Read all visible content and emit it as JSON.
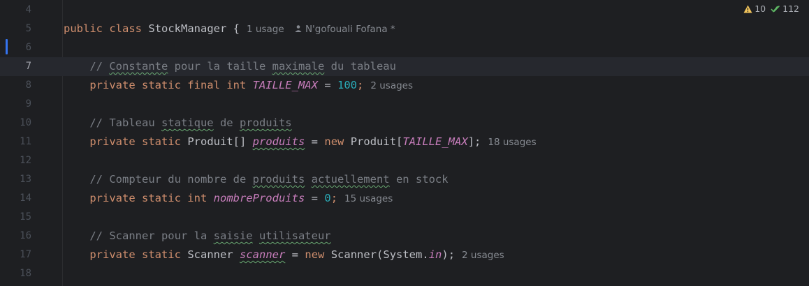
{
  "editor": {
    "current_line": 7,
    "inspection": {
      "warning_count": "10",
      "ok_count": "112"
    },
    "lines": [
      {
        "number": "4"
      },
      {
        "number": "5",
        "text": [
          "public",
          "class",
          "StockManager {"
        ],
        "hint": "1 usage",
        "author": "N'gofouali Fofana *"
      },
      {
        "number": "6"
      },
      {
        "number": "7",
        "comment": [
          "// ",
          "Constante",
          " pour la taille ",
          "maximale",
          " du tableau"
        ]
      },
      {
        "number": "8",
        "text": [
          "private static final int",
          "TAILLE_MAX",
          "=",
          "100",
          ";"
        ],
        "hint": "2 usages"
      },
      {
        "number": "9"
      },
      {
        "number": "10",
        "comment": [
          "// Tableau ",
          "statique",
          " de ",
          "produits"
        ]
      },
      {
        "number": "11",
        "text": [
          "private static",
          "Produit[]",
          "produits",
          "=",
          "new",
          "Produit[",
          "TAILLE_MAX",
          "];"
        ],
        "hint": "18 usages"
      },
      {
        "number": "12"
      },
      {
        "number": "13",
        "comment": [
          "// Compteur du nombre de ",
          "produits",
          " ",
          "actuellement",
          " en stock"
        ]
      },
      {
        "number": "14",
        "text": [
          "private static int",
          "nombreProduits",
          "=",
          "0",
          ";"
        ],
        "hint": "15 usages"
      },
      {
        "number": "15"
      },
      {
        "number": "16",
        "comment": [
          "// Scanner pour la ",
          "saisie",
          " ",
          "utilisateur"
        ]
      },
      {
        "number": "17",
        "text": [
          "private static",
          "Scanner",
          "scanner",
          "=",
          "new",
          "Scanner(System.",
          "in",
          ");"
        ],
        "hint": "2 usages"
      },
      {
        "number": "18"
      }
    ]
  }
}
